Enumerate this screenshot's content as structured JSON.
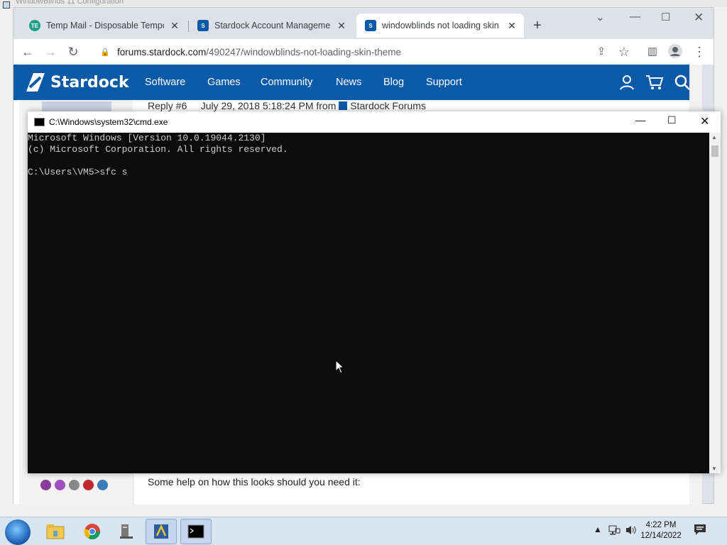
{
  "background_window": {
    "title": "WindowBlinds 11 Configuration"
  },
  "browser": {
    "tabs": [
      {
        "title": "Temp Mail - Disposable Temporary Email",
        "favicon": "temp-mail-favicon",
        "color": "#1d9f8a"
      },
      {
        "title": "Stardock Account Management",
        "favicon": "stardock-favicon",
        "color": "#0a5aa8"
      },
      {
        "title": "windowblinds not loading skin / theme",
        "favicon": "stardock-favicon",
        "color": "#0a5aa8",
        "active": true
      }
    ],
    "new_tab": "+",
    "url_host": "forums.stardock.com",
    "url_path": "/490247/windowblinds-not-loading-skin-theme"
  },
  "site": {
    "brand": "Stardock",
    "nav": [
      "Software",
      "Games",
      "Community",
      "News",
      "Blog",
      "Support"
    ],
    "reply_label": "Reply #6",
    "reply_date": "July 29, 2018 5:18:24 PM from",
    "reply_source": "Stardock Forums",
    "help_text": "Some help on how this looks should you need it:",
    "accent": "#0a5aa8"
  },
  "cmd": {
    "title": "C:\\Windows\\system32\\cmd.exe",
    "lines": [
      "Microsoft Windows [Version 10.0.19044.2130]",
      "(c) Microsoft Corporation. All rights reserved.",
      "",
      "C:\\Users\\VM5>sfc s"
    ]
  },
  "taskbar": {
    "apps": [
      "file-explorer",
      "chrome",
      "server-tool",
      "windowblinds",
      "cmd"
    ],
    "time": "4:22 PM",
    "date": "12/14/2022"
  }
}
